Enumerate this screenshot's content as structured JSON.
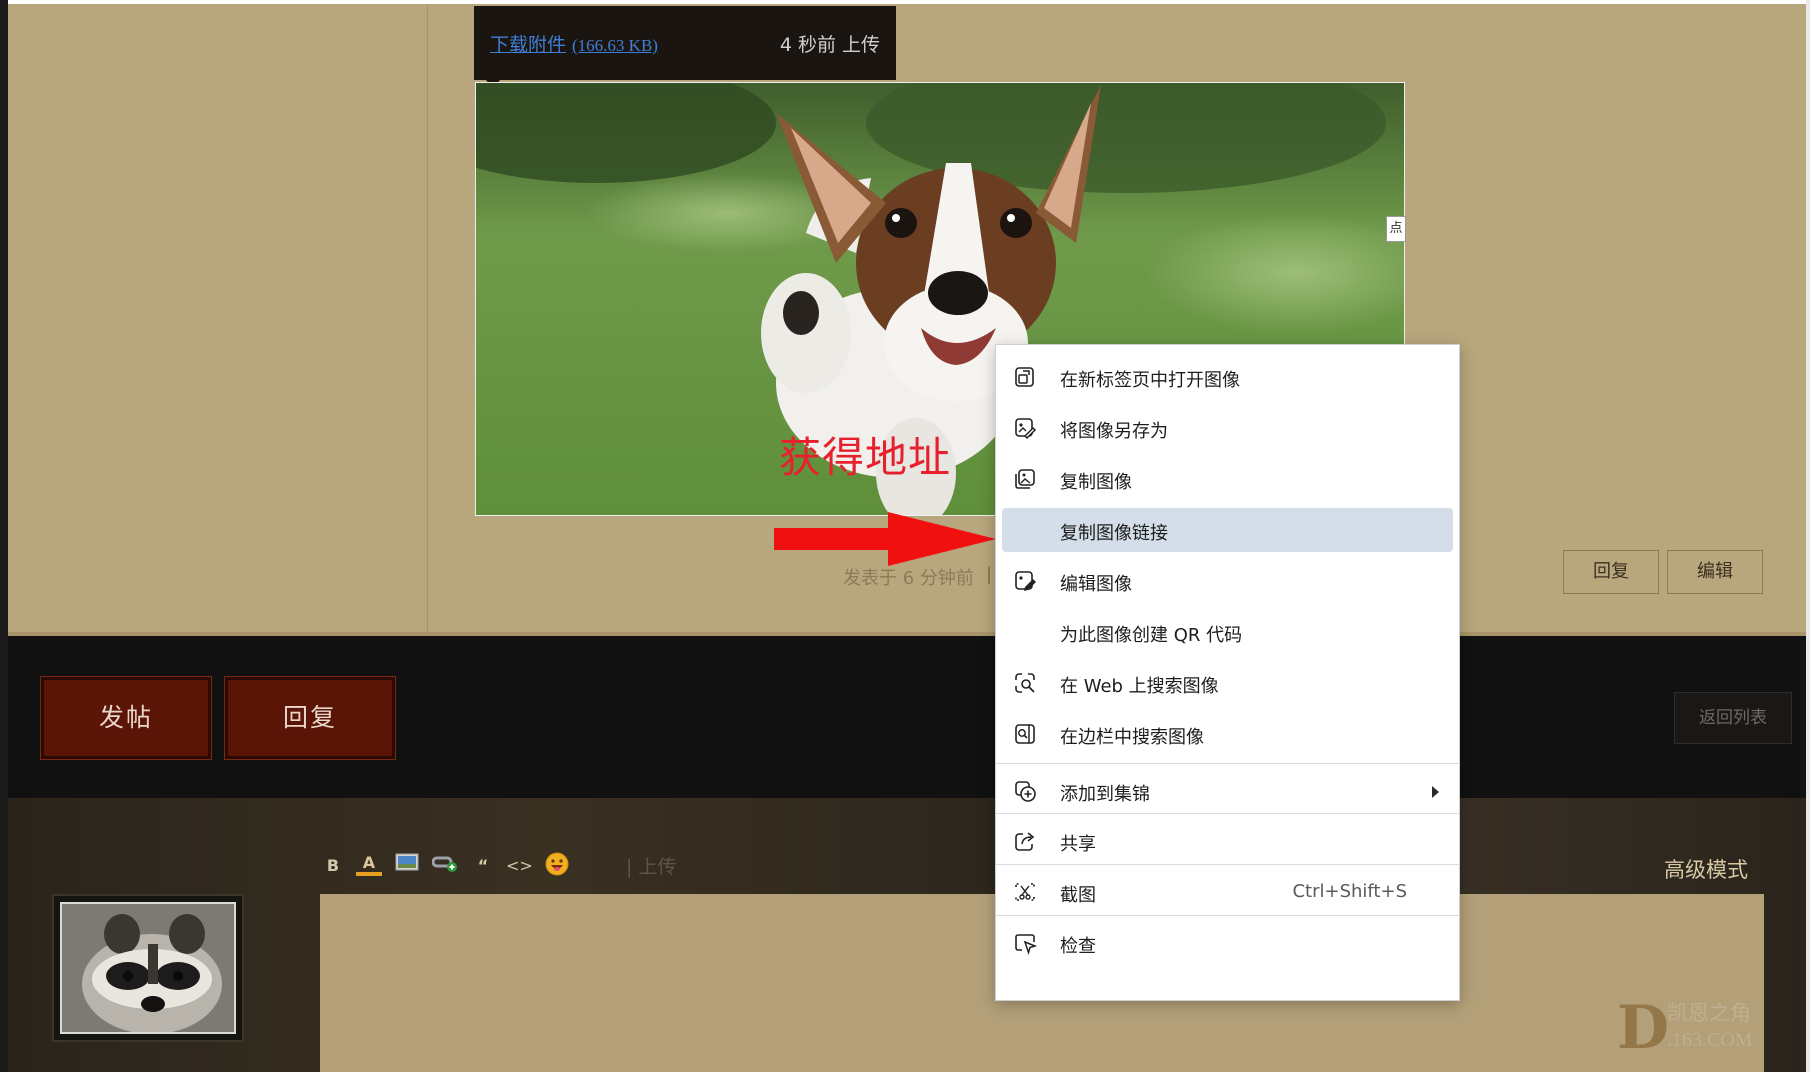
{
  "attachment": {
    "link_text": "下载附件",
    "size": "(166.63 KB)",
    "time": "4 秒前 上传"
  },
  "photo_side_tag": "点",
  "annotation": "获得地址",
  "post_meta": {
    "posted": "发表于 6 分钟前",
    "separator": "|"
  },
  "post_actions": {
    "reply": "回复",
    "edit": "编辑"
  },
  "thread_actions": {
    "post": "发帖",
    "reply": "回复",
    "back_to_list": "返回列表"
  },
  "editor": {
    "toolbar": [
      "B",
      "A",
      "image",
      "link",
      "“",
      "<>",
      "emoji"
    ],
    "upload": "| 上传",
    "advanced_mode": "高级模式"
  },
  "watermark": {
    "line1": "凯恩之角",
    "line2": ".163.COM",
    "letter": "D"
  },
  "context_menu": {
    "items": [
      {
        "label": "在新标签页中打开图像",
        "icon": "open-new-tab-icon"
      },
      {
        "label": "将图像另存为",
        "icon": "save-image-icon"
      },
      {
        "label": "复制图像",
        "icon": "copy-image-icon"
      },
      {
        "label": "复制图像链接",
        "icon": "",
        "highlighted": true
      },
      {
        "label": "编辑图像",
        "icon": "edit-image-icon"
      },
      {
        "label": "为此图像创建 QR 代码",
        "icon": ""
      },
      {
        "label": "在 Web 上搜索图像",
        "icon": "search-web-icon"
      },
      {
        "label": "在边栏中搜索图像",
        "icon": "search-sidebar-icon"
      },
      {
        "label": "添加到集锦",
        "icon": "add-collection-icon",
        "submenu": true
      },
      {
        "label": "共享",
        "icon": "share-icon"
      },
      {
        "label": "截图",
        "icon": "screenshot-icon",
        "shortcut": "Ctrl+Shift+S"
      },
      {
        "label": "检查",
        "icon": "inspect-icon"
      }
    ]
  },
  "colors": {
    "post_bg": "#b8a67d",
    "dark_band": "#121111",
    "button_red": "#5a1507",
    "link_blue": "#3f7fd6",
    "annotation_red": "#e8202e",
    "menu_highlight": "#d3dee8"
  }
}
